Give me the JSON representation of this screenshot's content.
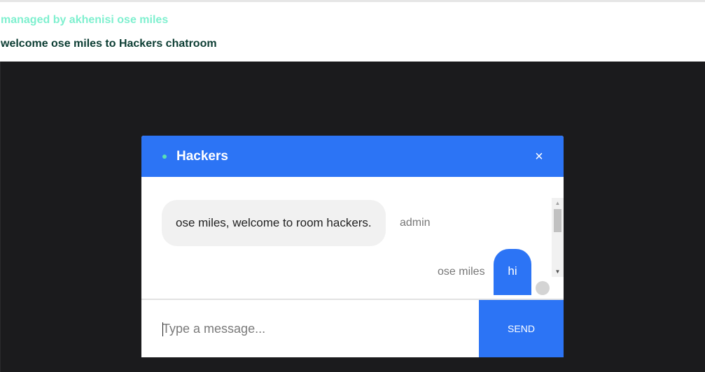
{
  "header": {
    "managed_text": "managed by akhenisi ose miles",
    "welcome_text": "welcome ose miles to Hackers chatroom"
  },
  "chat": {
    "room_title": "Hackers",
    "close_icon": "×",
    "messages": [
      {
        "text": "ose miles, welcome to room hackers.",
        "sender": "admin",
        "side": "left"
      },
      {
        "text": "hi",
        "sender": "ose miles",
        "side": "right"
      }
    ],
    "input_placeholder": "Type a message...",
    "send_label": "SEND"
  },
  "icons": {
    "online_indicator": "online-dot-icon",
    "close": "close-icon",
    "scroll_up": "scroll-up-arrow-icon",
    "scroll_down": "scroll-down-arrow-icon"
  },
  "colors": {
    "accent": "#2c74f5",
    "managed_text": "#7ff0cf",
    "welcome_text": "#0c3d33",
    "online_dot": "#59e0b4",
    "page_background": "#1b1b1d"
  }
}
